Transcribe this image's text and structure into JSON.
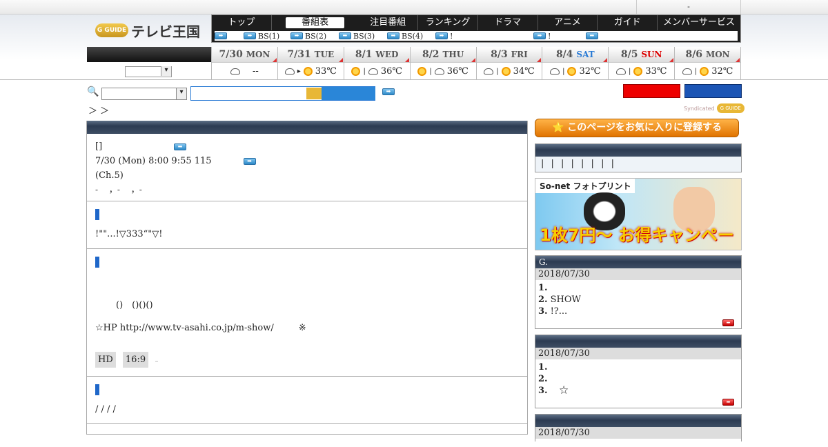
{
  "topbar": {
    "text": "-"
  },
  "logo": {
    "badge": "G GUIDE",
    "title": "テレビ王国"
  },
  "nav": {
    "tabs": [
      "トップ",
      "番組表",
      "注目番組",
      "ランキング",
      "ドラマ",
      "アニメ",
      "ガイド",
      "メンバーサービス"
    ],
    "active_tab": "番組表",
    "sub": [
      "BS(1)",
      "BS(2)",
      "BS(3)",
      "BS(4)",
      "!",
      "!"
    ]
  },
  "dates": [
    {
      "date": "7/30",
      "dow": "MON",
      "temp": "--",
      "kind": "plain"
    },
    {
      "date": "7/31",
      "dow": "TUE",
      "temp": "33℃",
      "kind": "plain"
    },
    {
      "date": "8/1",
      "dow": "WED",
      "temp": "36℃",
      "kind": "plain"
    },
    {
      "date": "8/2",
      "dow": "THU",
      "temp": "36℃",
      "kind": "plain"
    },
    {
      "date": "8/3",
      "dow": "FRI",
      "temp": "34℃",
      "kind": "plain"
    },
    {
      "date": "8/4",
      "dow": "SAT",
      "temp": "32℃",
      "kind": "sat"
    },
    {
      "date": "8/5",
      "dow": "SUN",
      "temp": "33℃",
      "kind": "sun"
    },
    {
      "date": "8/6",
      "dow": "MON",
      "temp": "32℃",
      "kind": "plain"
    }
  ],
  "breadcrumb": "＞ ＞",
  "syndicated": {
    "label": "Syndicated",
    "badge": "G GUIDE"
  },
  "program": {
    "title": "[]",
    "datetime": "7/30 (Mon) 8:00  9:55 115",
    "channel": "(Ch.5)",
    "cast": "-　 ，-　 ，-",
    "catch": "!\"\"...!▽333“\"▽!",
    "detail": "()　()()()",
    "hp": "☆HP  http://www.tv-asahi.co.jp/m-show/",
    "hp_mark": "※",
    "tags": [
      "HD",
      "16:9",
      ""
    ],
    "genre": "/ / / /"
  },
  "sidebar": {
    "fav_label": "⭐ このページをお気に入りに登録する",
    "pipes": "| | | | | | | |",
    "ad": {
      "brand": "So-net フォトプリント",
      "copy": "1枚7円〜 お得キャンペーン"
    },
    "ranking1": {
      "header": "G.",
      "date": "2018/07/30",
      "items": [
        {
          "num": "1.",
          "text": ""
        },
        {
          "num": "2.",
          "text": "SHOW"
        },
        {
          "num": "3.",
          "text": "!?..."
        }
      ]
    },
    "ranking2": {
      "header": "",
      "date": "2018/07/30",
      "items": [
        {
          "num": "1.",
          "text": ""
        },
        {
          "num": "2.",
          "text": ""
        },
        {
          "num": "3.",
          "text": "　☆"
        }
      ]
    },
    "ranking3": {
      "date": "2018/07/30"
    }
  }
}
